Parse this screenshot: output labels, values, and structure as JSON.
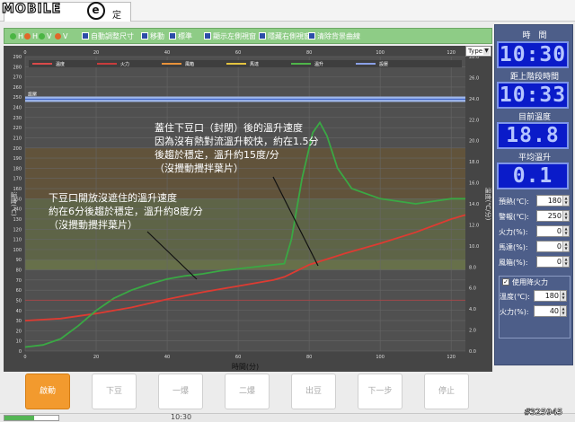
{
  "tab": {
    "label": "定"
  },
  "logo": {
    "text": "MOBILE",
    "mark": "e"
  },
  "toolbar": {
    "items": [
      {
        "kind": "dot",
        "label": "H",
        "color": "#4ab543"
      },
      {
        "kind": "dot",
        "label": "H",
        "color": "#e0672a"
      },
      {
        "kind": "dot",
        "label": "V",
        "color": "#4ab543"
      },
      {
        "kind": "dot",
        "label": "V",
        "color": "#e0672a"
      },
      {
        "kind": "icon",
        "label": "自動調整尺寸"
      },
      {
        "kind": "icon",
        "label": "移動"
      },
      {
        "kind": "icon",
        "label": "標準"
      },
      {
        "kind": "icon",
        "label": "顯示左側視窗"
      },
      {
        "kind": "icon",
        "label": "隱藏右側視窗"
      },
      {
        "kind": "icon",
        "label": "清除背景曲線"
      }
    ],
    "type_select": "Type"
  },
  "chart_data": {
    "type": "line",
    "xlabel": "時間(分)",
    "ylabel_left": "溫度(℃)",
    "ylabel_right": "溫度(℃/分)",
    "x_ticks": [
      "0",
      "20",
      "40",
      "60",
      "80",
      "100",
      "120"
    ],
    "xlim": [
      0,
      124
    ],
    "y_left_ticks": [
      "0",
      "10",
      "20",
      "30",
      "40",
      "50",
      "60",
      "70",
      "80",
      "90",
      "100",
      "110",
      "120",
      "130",
      "140",
      "150",
      "160",
      "170",
      "180",
      "190",
      "200",
      "210",
      "220",
      "230",
      "240",
      "250",
      "260",
      "270",
      "280",
      "290"
    ],
    "ylim_left": [
      0,
      290
    ],
    "y_right_ticks": [
      "0.0",
      "2.0",
      "4.0",
      "6.0",
      "8.0",
      "10.0",
      "12.0",
      "14.0",
      "16.0",
      "18.0",
      "20.0",
      "22.0",
      "24.0",
      "26.0",
      "28.0"
    ],
    "ylim_right": [
      0,
      28
    ],
    "legend": [
      {
        "name": "溫度",
        "color": "#d94a4a"
      },
      {
        "name": "火力",
        "color": "#c83c3c"
      },
      {
        "name": "風箱",
        "color": "#e8923a"
      },
      {
        "name": "馬達",
        "color": "#e4c340"
      },
      {
        "name": "溫升",
        "color": "#4fb54a"
      },
      {
        "name": "設壓",
        "color": "#8aa0e6"
      }
    ],
    "setpoint_label": "設壓",
    "setpoint_value": 248,
    "grid": true,
    "bands": [
      {
        "from": 80,
        "to": 90,
        "color": "#7a8b45"
      },
      {
        "from": 90,
        "to": 150,
        "color": "#6a7540"
      },
      {
        "from": 150,
        "to": 200,
        "color": "#70562a"
      }
    ],
    "series": [
      {
        "name": "溫度",
        "color": "#dd3b32",
        "x": [
          0,
          10,
          20,
          30,
          40,
          50,
          60,
          70,
          73,
          80,
          90,
          100,
          110,
          120,
          124
        ],
        "y": [
          30,
          32,
          37,
          43,
          51,
          58,
          64,
          70,
          73,
          85,
          96,
          106,
          117,
          130,
          134
        ]
      },
      {
        "name": "溫升",
        "color": "#3aa844",
        "x": [
          0,
          5,
          10,
          15,
          20,
          25,
          30,
          35,
          40,
          45,
          50,
          55,
          60,
          65,
          70,
          73,
          75,
          78,
          81,
          83,
          85,
          88,
          92,
          96,
          100,
          110,
          120,
          124
        ],
        "y": [
          4,
          6,
          12,
          25,
          40,
          52,
          60,
          66,
          71,
          74,
          76,
          79,
          81,
          83,
          85,
          86,
          110,
          170,
          215,
          225,
          212,
          180,
          160,
          155,
          150,
          145,
          150,
          150
        ]
      },
      {
        "name": "火力",
        "color": "#c9373a",
        "x": [
          0,
          124
        ],
        "y": [
          50,
          50
        ]
      }
    ]
  },
  "annotations": {
    "note1": [
      "蓋住下豆口（封閉）後的溫升速度",
      "因為沒有熱對流溫升較快，約在1.5分",
      "後趨於穩定，溫升約15度/分",
      "（沒攪動攪拌葉片）"
    ],
    "note2": [
      "下豆口開放沒遮住的溫升速度",
      "約在6分後趨於穩定，溫升約8度/分",
      "（沒攪動攪拌葉片）"
    ]
  },
  "panel": {
    "title_time": "時　間",
    "lcd_time": "10:30",
    "title_stage": "距上階段時間",
    "lcd_stage": "10:33",
    "title_temp": "目前溫度",
    "lcd_temp": "18.8",
    "title_rise": "平均溫升",
    "lcd_rise": "0.1",
    "fields": [
      {
        "label": "預熱(℃):",
        "value": "180"
      },
      {
        "label": "警報(℃):",
        "value": "250"
      },
      {
        "label": "火力(%):",
        "value": "0"
      },
      {
        "label": "馬達(%):",
        "value": "0"
      },
      {
        "label": "風箱(%):",
        "value": "0"
      }
    ],
    "checkbox_label": "使用降火力",
    "checkbox_checked": true,
    "sub_fields": [
      {
        "label": "溫度(℃):",
        "value": "180"
      },
      {
        "label": "火力(%):",
        "value": "40"
      }
    ]
  },
  "buttons": [
    "啟動",
    "下豆",
    "一爆",
    "二爆",
    "出豆",
    "下一步",
    "停止"
  ],
  "status": {
    "time": "10:30",
    "progress": 0.55
  },
  "watermark": "#325945"
}
